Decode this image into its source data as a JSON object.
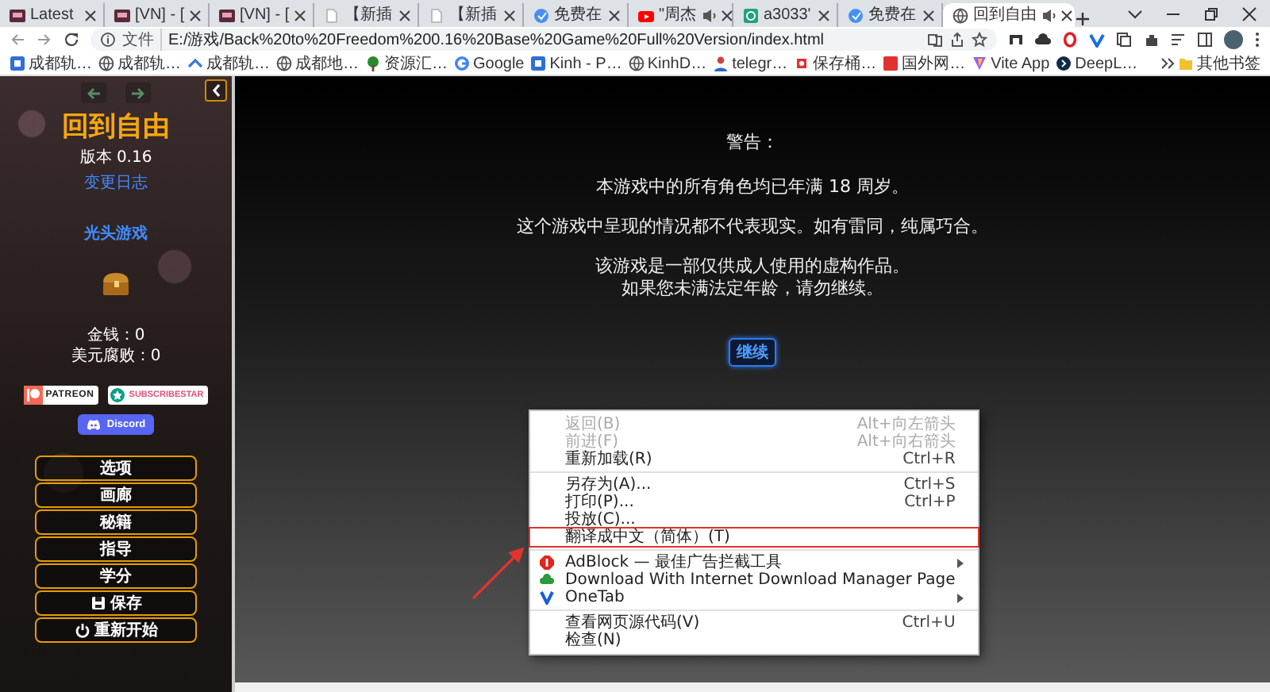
{
  "browser": {
    "tabs": [
      {
        "title": "Latest",
        "kind": "f95",
        "audio": false,
        "selected": false
      },
      {
        "title": "[VN] - [",
        "kind": "f95",
        "audio": false,
        "selected": false
      },
      {
        "title": "[VN] - [",
        "kind": "f95",
        "audio": false,
        "selected": false
      },
      {
        "title": "【新插",
        "kind": "page",
        "audio": false,
        "selected": false
      },
      {
        "title": "【新插",
        "kind": "page",
        "audio": false,
        "selected": false
      },
      {
        "title": "免费在",
        "kind": "blue-circle",
        "audio": false,
        "selected": false
      },
      {
        "title": "\"周杰",
        "kind": "youtube",
        "audio": true,
        "selected": false
      },
      {
        "title": "a3033'",
        "kind": "green-square",
        "audio": false,
        "selected": false
      },
      {
        "title": "免费在",
        "kind": "blue-circle",
        "audio": false,
        "selected": false
      },
      {
        "title": "回到自由",
        "kind": "globe",
        "audio": true,
        "selected": true
      }
    ],
    "address_bar": {
      "scheme": "文件",
      "url": "E:/游戏/Back%20to%20Freedom%200.16%20Base%20Game%20Full%20Version/index.html"
    },
    "bookmarks": [
      {
        "label": "成都轨…",
        "kind": "blue-square"
      },
      {
        "label": "成都轨…",
        "kind": "globe"
      },
      {
        "label": "成都轨…",
        "kind": "arrow"
      },
      {
        "label": "成都地…",
        "kind": "globe"
      },
      {
        "label": "资源汇…",
        "kind": "tree"
      },
      {
        "label": "Google",
        "kind": "google"
      },
      {
        "label": "Kinh - P…",
        "kind": "blue-square"
      },
      {
        "label": "KinhD…",
        "kind": "globe"
      },
      {
        "label": "telegr…",
        "kind": "person"
      },
      {
        "label": "保存桶…",
        "kind": "plugin"
      },
      {
        "label": "国外网…",
        "kind": "red-square"
      },
      {
        "label": "Vite App",
        "kind": "vite"
      },
      {
        "label": "DeepL…",
        "kind": "dark-circle"
      }
    ],
    "other_bookmarks": "其他书签"
  },
  "sidebar": {
    "nav": [
      {
        "kind": "back",
        "disabled": true
      },
      {
        "kind": "forward",
        "disabled": true
      }
    ],
    "title": "回到自由",
    "version": "版本 0.16",
    "changelog": "变更日志",
    "developer": "光头游戏",
    "stats": [
      "金钱：0",
      "美元腐败：0"
    ],
    "badges": [
      {
        "kind": "patreon",
        "label": "PATREON"
      },
      {
        "kind": "subscribestar",
        "label": "SUBSCRIBESTAR"
      },
      {
        "kind": "discord",
        "label": "Discord"
      }
    ],
    "menu": [
      {
        "label": "选项",
        "kind": "plain"
      },
      {
        "label": "画廊",
        "kind": "plain"
      },
      {
        "label": "秘籍",
        "kind": "plain"
      },
      {
        "label": "指导",
        "kind": "plain"
      },
      {
        "label": "学分",
        "kind": "plain"
      },
      {
        "label": "保存",
        "kind": "save"
      },
      {
        "label": "重新开始",
        "kind": "power"
      }
    ]
  },
  "warning": {
    "heading": "警告：",
    "paragraphs": [
      [
        "本游戏中的所有角色均已年满 18 周岁。"
      ],
      [
        "这个游戏中呈现的情况都不代表现实。如有雷同，纯属巧合。"
      ],
      [
        "该游戏是一部仅供成人使用的虚构作品。",
        "如果您未满法定年龄，请勿继续。"
      ]
    ],
    "continue_button": "继续"
  },
  "context_menu": {
    "items": [
      {
        "kind": "item",
        "label": "返回(B)",
        "shortcut": "Alt+向左箭头",
        "disabled": true,
        "submenu": false,
        "annotated": false
      },
      {
        "kind": "item",
        "label": "前进(F)",
        "shortcut": "Alt+向右箭头",
        "disabled": true,
        "submenu": false,
        "annotated": false
      },
      {
        "kind": "item",
        "label": "重新加载(R)",
        "shortcut": "Ctrl+R",
        "disabled": false,
        "submenu": false,
        "annotated": false
      },
      {
        "kind": "separator"
      },
      {
        "kind": "item",
        "label": "另存为(A)...",
        "shortcut": "Ctrl+S",
        "disabled": false,
        "submenu": false,
        "annotated": false
      },
      {
        "kind": "item",
        "label": "打印(P)...",
        "shortcut": "Ctrl+P",
        "disabled": false,
        "submenu": false,
        "annotated": false
      },
      {
        "kind": "item",
        "label": "投放(C)...",
        "disabled": false,
        "submenu": false,
        "annotated": false
      },
      {
        "kind": "item",
        "label": "翻译成中文（简体）(T)",
        "disabled": false,
        "submenu": false,
        "annotated": true
      },
      {
        "kind": "separator"
      },
      {
        "kind": "adblock",
        "label": "AdBlock — 最佳广告拦截工具",
        "disabled": false,
        "submenu": true,
        "annotated": false
      },
      {
        "kind": "idm",
        "label": "Download With Internet Download Manager Page",
        "disabled": false,
        "submenu": false,
        "annotated": false
      },
      {
        "kind": "onetab",
        "label": "OneTab",
        "disabled": false,
        "submenu": true,
        "annotated": false
      },
      {
        "kind": "separator"
      },
      {
        "kind": "item",
        "label": "查看网页源代码(V)",
        "shortcut": "Ctrl+U",
        "disabled": false,
        "submenu": false,
        "annotated": false
      },
      {
        "kind": "item",
        "label": "检查(N)",
        "disabled": false,
        "submenu": false,
        "annotated": false
      }
    ]
  }
}
